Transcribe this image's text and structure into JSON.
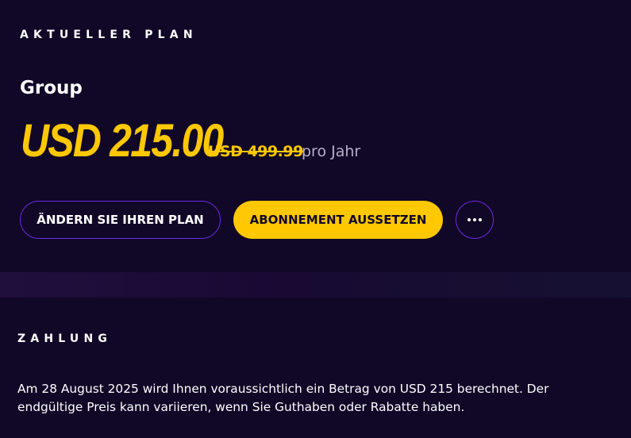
{
  "plan": {
    "section_label": "AKTUELLER PLAN",
    "name": "Group",
    "price": "USD 215.00",
    "original_price": "USD 499.99",
    "period": "pro Jahr",
    "change_plan_label": "ÄNDERN SIE IHREN PLAN",
    "pause_label": "ABONNEMENT AUSSETZEN",
    "more_icon": "more-horizontal-icon"
  },
  "payment": {
    "section_label": "ZAHLUNG",
    "text": "Am 28 August 2025 wird Ihnen voraussichtlich ein Betrag von USD 215 berechnet. Der endgültige Preis kann variieren, wenn Sie Guthaben oder Rabatte haben."
  },
  "colors": {
    "background": "#110727",
    "accent": "#ffc800",
    "outline": "#6d2ae0",
    "muted_text": "#b7afc9"
  }
}
